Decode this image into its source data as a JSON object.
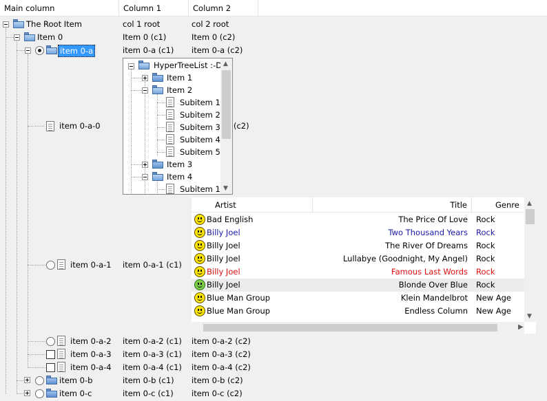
{
  "columns": [
    "Main column",
    "Column 1",
    "Column 2"
  ],
  "rows": {
    "root": {
      "label": "The Root Item",
      "c1": "col 1 root",
      "c2": "col 2 root"
    },
    "item0": {
      "label": "Item 0",
      "c1": "Item 0 (c1)",
      "c2": "Item 0 (c2)"
    },
    "item0a": {
      "label": "item 0-a",
      "c1": "item 0-a (c1)",
      "c2": "item 0-a (c2)"
    },
    "item0a0": {
      "label": "item 0-a-0",
      "c2_partial": "(c2)"
    },
    "item0a1": {
      "label": "item 0-a-1",
      "c1": "item 0-a-1 (c1)"
    },
    "item0a2": {
      "label": "item 0-a-2",
      "c1": "item 0-a-2 (c1)",
      "c2": "item 0-a-2 (c2)"
    },
    "item0a3": {
      "label": "item 0-a-3",
      "c1": "item 0-a-3 (c1)",
      "c2": "item 0-a-3 (c2)"
    },
    "item0a4": {
      "label": "item 0-a-4",
      "c1": "item 0-a-4 (c1)",
      "c2": "item 0-a-4 (c2)"
    },
    "item0b": {
      "label": "item 0-b",
      "c1": "item 0-b (c1)",
      "c2": "item 0-b (c2)"
    },
    "item0c": {
      "label": "item 0-c",
      "c1": "item 0-c (c1)",
      "c2": "item 0-c (c2)"
    }
  },
  "embedded_tree": {
    "root": "HyperTreeList :-D",
    "item1": "Item 1",
    "item2": "Item 2",
    "subitems": [
      "Subitem 1",
      "Subitem 2",
      "Subitem 3",
      "Subitem 4",
      "Subitem 5"
    ],
    "item3": "Item 3",
    "item4": "Item 4",
    "item4_sub1": "Subitem 1"
  },
  "music_list": {
    "headers": {
      "artist": "Artist",
      "title": "Title",
      "genre": "Genre"
    },
    "rows": [
      {
        "artist": "Bad English",
        "title": "The Price Of Love",
        "genre": "Rock",
        "color": "#000000"
      },
      {
        "artist": "Billy Joel",
        "title": "Two Thousand Years",
        "genre": "Rock",
        "color": "#1a1aa6"
      },
      {
        "artist": "Billy Joel",
        "title": "The River Of Dreams",
        "genre": "Rock",
        "color": "#000000"
      },
      {
        "artist": "Billy Joel",
        "title": "Lullabye (Goodnight, My Angel)",
        "genre": "Rock",
        "color": "#000000"
      },
      {
        "artist": "Billy Joel",
        "title": "Famous Last Words",
        "genre": "Rock",
        "color": "#e01010"
      },
      {
        "artist": "Billy Joel",
        "title": "Blonde Over Blue",
        "genre": "Rock",
        "color": "#000000"
      },
      {
        "artist": "Blue Man Group",
        "title": "Klein Mandelbrot",
        "genre": "New Age",
        "color": "#000000"
      },
      {
        "artist": "Blue Man Group",
        "title": "Endless Column",
        "genre": "New Age",
        "color": "#000000"
      }
    ]
  }
}
